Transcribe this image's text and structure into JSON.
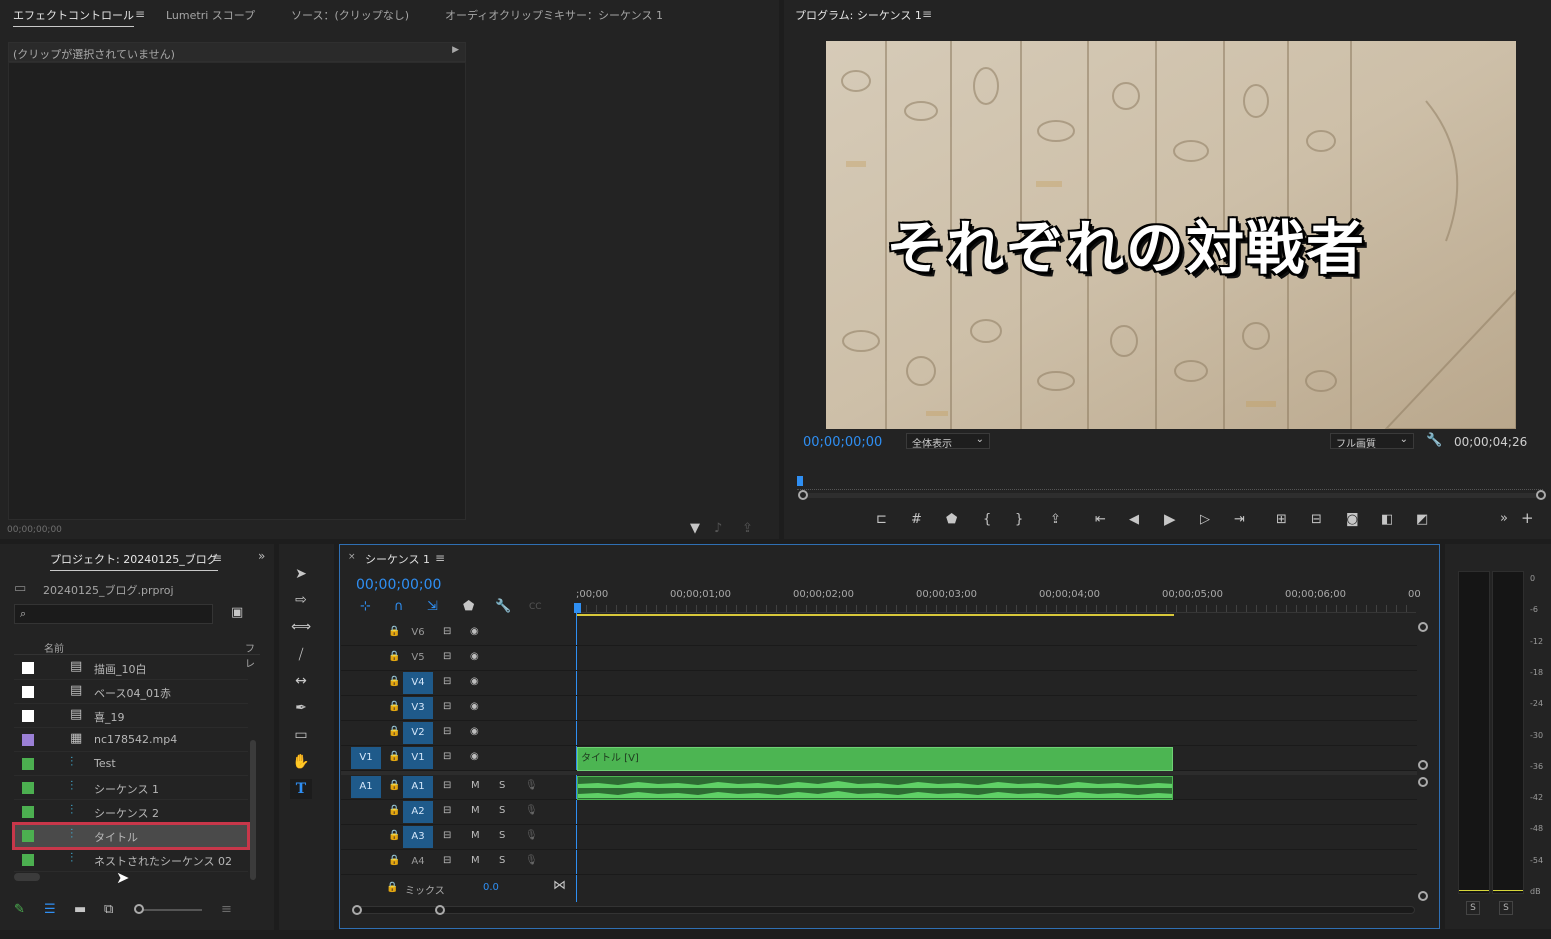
{
  "effect_panel": {
    "tabs": [
      "エフェクトコントロール",
      "Lumetri スコープ",
      "ソース：(クリップなし)",
      "オーディオクリップミキサー：シーケンス 1"
    ],
    "no_clip_text": "(クリップが選択されていません)",
    "timecode": "00;00;00;00"
  },
  "program_monitor": {
    "title": "プログラム: シーケンス 1",
    "overlay_text": "それぞれの対戦者",
    "timecode_current": "00;00;00;00",
    "zoom_select": "全体表示",
    "quality_select": "フル画質",
    "timecode_duration": "00;00;04;26"
  },
  "project_panel": {
    "tab": "プロジェクト: 20240125_ブログ",
    "file": "20240125_ブログ.prproj",
    "search_placeholder": "",
    "col_name": "名前",
    "col_fps": "フレ",
    "items": [
      {
        "name": "描画_10白",
        "color": "#ffffff",
        "icon": "psd-icon"
      },
      {
        "name": "ベース04_01赤",
        "color": "#ffffff",
        "icon": "psd-icon"
      },
      {
        "name": "喜_19",
        "color": "#ffffff",
        "icon": "psd-icon"
      },
      {
        "name": "nc178542.mp4",
        "color": "#9b80d6",
        "icon": "film-icon"
      },
      {
        "name": "Test",
        "color": "#4caf50",
        "icon": "sequence-icon"
      },
      {
        "name": "シーケンス 1",
        "color": "#4caf50",
        "icon": "sequence-icon"
      },
      {
        "name": "シーケンス 2",
        "color": "#4caf50",
        "icon": "sequence-icon"
      },
      {
        "name": "タイトル",
        "color": "#4caf50",
        "icon": "sequence-icon",
        "selected": true
      },
      {
        "name": "ネストされたシーケンス 02",
        "color": "#4caf50",
        "icon": "sequence-icon"
      }
    ]
  },
  "timeline": {
    "tab": "シーケンス 1",
    "timecode": "00;00;00;00",
    "ruler": [
      ";00;00",
      "00;00;01;00",
      "00;00;02;00",
      "00;00;03;00",
      "00;00;04;00",
      "00;00;05;00",
      "00;00;06;00",
      "00"
    ],
    "video_tracks": [
      {
        "label": "V6",
        "on": false
      },
      {
        "label": "V5",
        "on": false
      },
      {
        "label": "V4",
        "on": true
      },
      {
        "label": "V3",
        "on": true
      },
      {
        "label": "V2",
        "on": true
      },
      {
        "label": "V1",
        "on": true,
        "source": "V1"
      }
    ],
    "audio_tracks": [
      {
        "label": "A1",
        "on": true,
        "source": "A1"
      },
      {
        "label": "A2",
        "on": true
      },
      {
        "label": "A3",
        "on": true
      },
      {
        "label": "A4",
        "on": false
      }
    ],
    "mute_label": "M",
    "solo_label": "S",
    "mix_label": "ミックス",
    "mix_value": "0.0",
    "clip_label": "タイトル [V]"
  },
  "audio_meter": {
    "scale": [
      "0",
      "-6",
      "-12",
      "-18",
      "-24",
      "-30",
      "-36",
      "-42",
      "-48",
      "-54",
      "dB"
    ],
    "solo_left": "S",
    "solo_right": "S"
  },
  "colors": {
    "accent": "#2f8ff3",
    "clip_green": "#4cb552",
    "track_blue": "#1f5a8a",
    "selection_red": "#c8374a"
  }
}
